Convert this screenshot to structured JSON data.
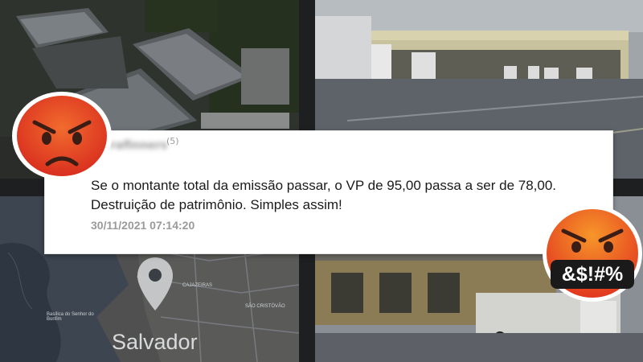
{
  "comment_card": {
    "username": "rafinners",
    "user_count": "(5)",
    "text": "Se o montante total da emissão passar, o VP de 95,00 passa a ser de 78,00. Destruição de patrimônio. Simples assim!",
    "timestamp": "30/11/2021 07:14:20"
  },
  "map_panel": {
    "city_label": "Salvador",
    "labels": [
      "CAJAZEIRAS",
      "SÃO CRISTÓVÃO",
      "Basílica do Senhor do Bonfim"
    ]
  },
  "emojis": {
    "angry_face": "angry-face-icon",
    "cursing_face": "cursing-face-icon",
    "cursing_symbols": "&$!#%"
  },
  "colors": {
    "card_background": "#ffffff",
    "timestamp_gray": "#9a9a9a",
    "emoji_red": "#e2371f",
    "emoji_orange": "#f68b1f"
  }
}
